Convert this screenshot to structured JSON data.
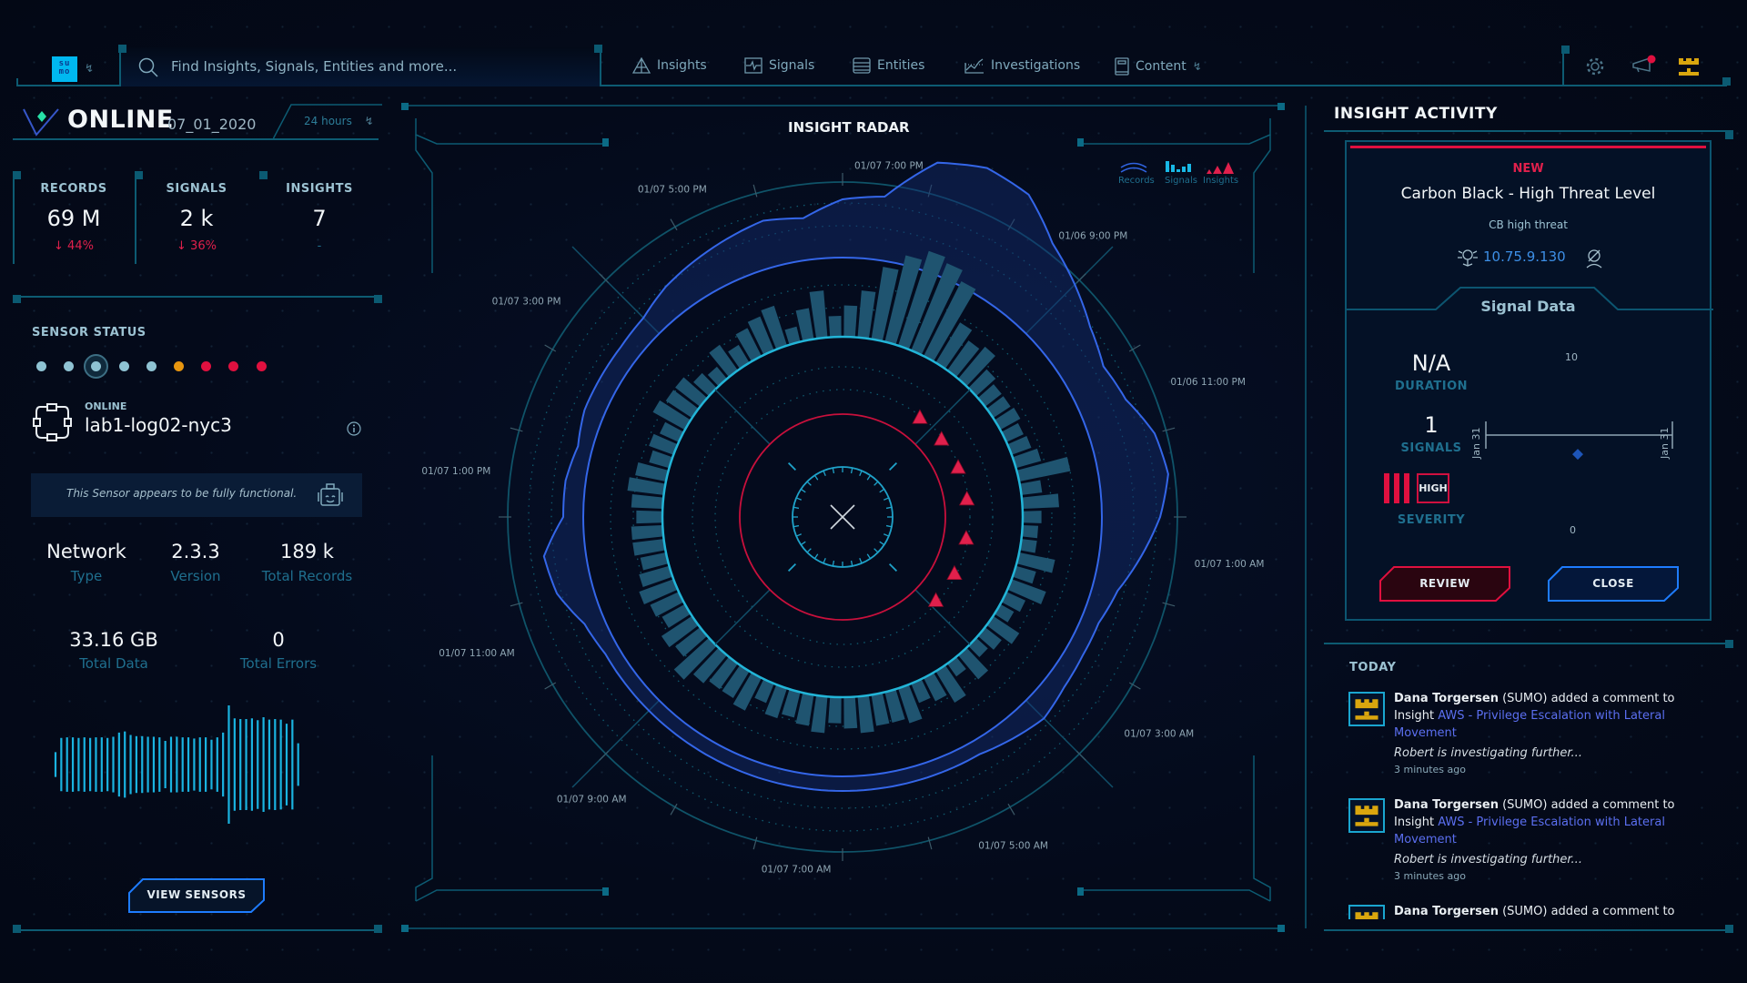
{
  "header": {
    "logo_text": "su mo",
    "search_placeholder": "Find Insights, Signals, Entities and more...",
    "nav": [
      {
        "label": "Insights",
        "icon": "insights-pyramid-icon"
      },
      {
        "label": "Signals",
        "icon": "signals-pulse-icon"
      },
      {
        "label": "Entities",
        "icon": "entities-stack-icon"
      },
      {
        "label": "Investigations",
        "icon": "investigations-chart-icon"
      },
      {
        "label": "Content",
        "icon": "content-document-icon",
        "has_dropdown": true
      }
    ],
    "notification_dot": true
  },
  "left_panel": {
    "status": "ONLINE",
    "date": "07_01_2020",
    "time_range": "24 hours",
    "stats": [
      {
        "label": "RECORDS",
        "value": "69 M",
        "change": "↓ 44%"
      },
      {
        "label": "SIGNALS",
        "value": "2 k",
        "change": "↓ 36%"
      },
      {
        "label": "INSIGHTS",
        "value": "7",
        "change": "-"
      }
    ],
    "sensor_status_label": "SENSOR STATUS",
    "sensor_dots": [
      {
        "status": "ok",
        "color": "#8fc3d3"
      },
      {
        "status": "ok",
        "color": "#8fc3d3"
      },
      {
        "status": "selected",
        "color": "#8fc3d3"
      },
      {
        "status": "ok",
        "color": "#8fc3d3"
      },
      {
        "status": "ok",
        "color": "#8fc3d3"
      },
      {
        "status": "warning",
        "color": "#e8960f"
      },
      {
        "status": "error",
        "color": "#e0103f"
      },
      {
        "status": "error",
        "color": "#e0103f"
      },
      {
        "status": "error",
        "color": "#e0103f"
      }
    ],
    "sensor": {
      "state": "ONLINE",
      "name": "lab1-log02-nyc3",
      "notice": "This Sensor appears to be fully functional.",
      "meta": [
        {
          "value": "Network",
          "label": "Type"
        },
        {
          "value": "2.3.3",
          "label": "Version"
        },
        {
          "value": "189 k",
          "label": "Total Records"
        },
        {
          "value": "33.16 GB",
          "label": "Total Data"
        },
        {
          "value": "0",
          "label": "Total Errors"
        }
      ],
      "waveform": [
        0.21,
        0.45,
        0.46,
        0.46,
        0.45,
        0.46,
        0.45,
        0.46,
        0.46,
        0.45,
        0.47,
        0.54,
        0.56,
        0.5,
        0.48,
        0.48,
        0.47,
        0.47,
        0.46,
        0.4,
        0.47,
        0.47,
        0.46,
        0.46,
        0.44,
        0.46,
        0.46,
        0.42,
        0.46,
        0.54,
        1.0,
        0.78,
        0.77,
        0.77,
        0.78,
        0.75,
        0.8,
        0.76,
        0.77,
        0.76,
        0.69,
        0.76,
        0.36
      ]
    },
    "view_sensors_label": "VIEW SENSORS"
  },
  "radar": {
    "title": "INSIGHT RADAR",
    "legend": [
      {
        "label": "Records",
        "color": "#2f63e0"
      },
      {
        "label": "Signals",
        "color": "#18b8e6"
      },
      {
        "label": "Insights",
        "color": "#e0204c"
      }
    ],
    "time_labels": [
      {
        "label": "01/06 9:00 PM",
        "hour": 21
      },
      {
        "label": "01/06 11:00 PM",
        "hour": 23
      },
      {
        "label": "01/07 1:00 AM",
        "hour": 25
      },
      {
        "label": "01/07 3:00 AM",
        "hour": 27
      },
      {
        "label": "01/07 5:00 AM",
        "hour": 29
      },
      {
        "label": "01/07 7:00 AM",
        "hour": 31
      },
      {
        "label": "01/07 9:00 AM",
        "hour": 33
      },
      {
        "label": "01/07 11:00 AM",
        "hour": 35
      },
      {
        "label": "01/07 1:00 PM",
        "hour": 37
      },
      {
        "label": "01/07 3:00 PM",
        "hour": 39
      },
      {
        "label": "01/07 5:00 PM",
        "hour": 41
      },
      {
        "label": "01/07 7:00 PM",
        "hour": 43
      }
    ],
    "records": [
      0.45,
      0.5,
      0.9,
      1.0,
      0.95,
      0.7,
      0.55,
      0.4,
      0.3,
      0.35,
      0.5,
      0.55,
      0.45,
      0.3,
      0.15,
      0.08,
      0.08,
      0.1,
      0.15,
      0.1,
      0.05,
      0.05,
      0.05,
      0.05,
      0.05,
      0.05,
      0.05,
      0.05,
      0.05,
      0.05,
      0.05,
      0.05,
      0.05,
      0.1,
      0.25,
      0.3,
      0.1,
      0.1,
      0.05,
      0.1,
      0.1,
      0.1,
      0.12,
      0.2,
      0.25,
      0.3,
      0.35,
      0.3
    ],
    "signals": [
      0.3,
      0.45,
      0.7,
      0.85,
      0.95,
      0.9,
      0.8,
      0.45,
      0.35,
      0.4,
      0.25,
      0.2,
      0.2,
      0.22,
      0.18,
      0.2,
      0.25,
      0.5,
      0.2,
      0.35,
      0.18,
      0.15,
      0.15,
      0.35,
      0.2,
      0.35,
      0.2,
      0.15,
      0.3,
      0.2,
      0.15,
      0.3,
      0.15,
      0.35,
      0.25,
      0.2,
      0.35,
      0.3,
      0.3,
      0.35,
      0.3,
      0.25,
      0.35,
      0.3,
      0.25,
      0.3,
      0.2,
      0.35,
      0.3,
      0.3,
      0.35,
      0.45,
      0.3,
      0.35,
      0.25,
      0.3,
      0.35,
      0.3,
      0.25,
      0.3,
      0.3,
      0.25,
      0.3,
      0.35,
      0.3,
      0.2,
      0.25,
      0.2,
      0.35,
      0.3,
      0.3,
      0.2,
      0.15,
      0.3,
      0.2,
      0.3,
      0.35,
      0.4,
      0.15,
      0.3,
      0.45,
      0.2
    ],
    "insights": [
      {
        "angle": 38,
        "size": "small"
      },
      {
        "angle": 52,
        "size": "small"
      },
      {
        "angle": 67,
        "size": "small"
      },
      {
        "angle": 82,
        "size": "small"
      },
      {
        "angle": 100,
        "size": "small"
      },
      {
        "angle": 117,
        "size": "small"
      },
      {
        "angle": 132,
        "size": "small"
      }
    ]
  },
  "insight_activity": {
    "title": "INSIGHT ACTIVITY",
    "card": {
      "badge": "NEW",
      "title": "Carbon Black - High Threat Level",
      "subtitle": "CB high threat",
      "entity_ip": "10.75.9.130",
      "tab_label": "Signal Data",
      "duration_value": "N/A",
      "duration_label": "DURATION",
      "signals_value": "1",
      "signals_label": "SIGNALS",
      "severity_value": "HIGH",
      "severity_label": "SEVERITY",
      "severity_bars": 3,
      "timeline": {
        "y_max": "10",
        "y_min": "0",
        "x_start": "Jan 31",
        "x_end": "Jan 31",
        "point_value": 3.5
      },
      "review_label": "REVIEW",
      "close_label": "CLOSE"
    },
    "feed_heading": "TODAY",
    "feed": [
      {
        "user": "Dana Torgersen",
        "org": "(SUMO)",
        "action": "added a comment to Insight",
        "link": "AWS - Privilege Escalation with Lateral Movement",
        "note": "Robert is investigating further...",
        "time": "3 minutes ago"
      },
      {
        "user": "Dana Torgersen",
        "org": "(SUMO)",
        "action": "added a comment to Insight",
        "link": "AWS - Privilege Escalation with Lateral Movement",
        "note": "Robert is investigating further...",
        "time": "3 minutes ago"
      },
      {
        "user": "Dana Torgersen",
        "org": "(SUMO)",
        "action": "added a comment to",
        "link": "",
        "note": "",
        "time": ""
      }
    ]
  }
}
